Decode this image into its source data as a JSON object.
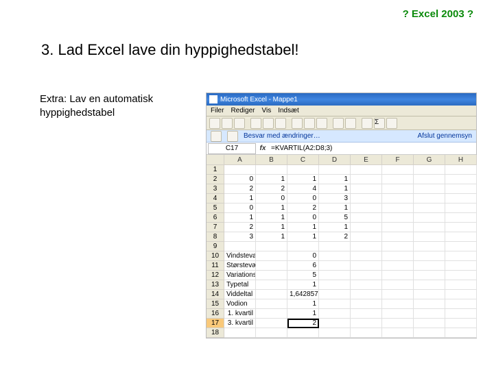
{
  "topLabel": "? Excel 2003 ?",
  "heading": "3. Lad Excel lave din hyppighedstabel!",
  "subtext": "Extra: Lav en automatisk hyppighedstabel",
  "excel": {
    "title": "Microsoft Excel - Mappe1",
    "menu": {
      "m0": "Filer",
      "m1": "Rediger",
      "m2": "Vis",
      "m3": "Indsæt"
    },
    "review": {
      "label": "Besvar med ændringer…",
      "end": "Afslut gennemsyn"
    },
    "namebox": "C17",
    "formula": "=KVARTIL(A2:D8;3)",
    "cols": {
      "A": "A",
      "B": "B",
      "C": "C",
      "D": "D",
      "E": "E",
      "F": "F",
      "G": "G",
      "H": "H"
    },
    "rows": [
      {
        "n": "1",
        "A": "",
        "B": "",
        "C": "",
        "D": ""
      },
      {
        "n": "2",
        "A": "0",
        "B": "1",
        "C": "1",
        "D": "1"
      },
      {
        "n": "3",
        "A": "2",
        "B": "2",
        "C": "4",
        "D": "1"
      },
      {
        "n": "4",
        "A": "1",
        "B": "0",
        "C": "0",
        "D": "3"
      },
      {
        "n": "5",
        "A": "0",
        "B": "1",
        "C": "2",
        "D": "1"
      },
      {
        "n": "6",
        "A": "1",
        "B": "1",
        "C": "0",
        "D": "5"
      },
      {
        "n": "7",
        "A": "2",
        "B": "1",
        "C": "1",
        "D": "1"
      },
      {
        "n": "8",
        "A": "3",
        "B": "1",
        "C": "1",
        "D": "2"
      },
      {
        "n": "9",
        "A": "",
        "B": "",
        "C": "",
        "D": ""
      },
      {
        "n": "10",
        "A": "Vindsteværdi",
        "C": "0"
      },
      {
        "n": "11",
        "A": "Størsteværdi",
        "C": "6"
      },
      {
        "n": "12",
        "A": "Variationsbredde",
        "C": "5"
      },
      {
        "n": "13",
        "A": "Typetal",
        "C": "1"
      },
      {
        "n": "14",
        "A": "Viddeltal",
        "C": "1,642857"
      },
      {
        "n": "15",
        "A": "Vodion",
        "C": "1"
      },
      {
        "n": "16",
        "A": "1. kvartil",
        "C": "1"
      },
      {
        "n": "17",
        "A": "3. kvartil",
        "C": "2"
      },
      {
        "n": "18",
        "A": ""
      }
    ]
  }
}
